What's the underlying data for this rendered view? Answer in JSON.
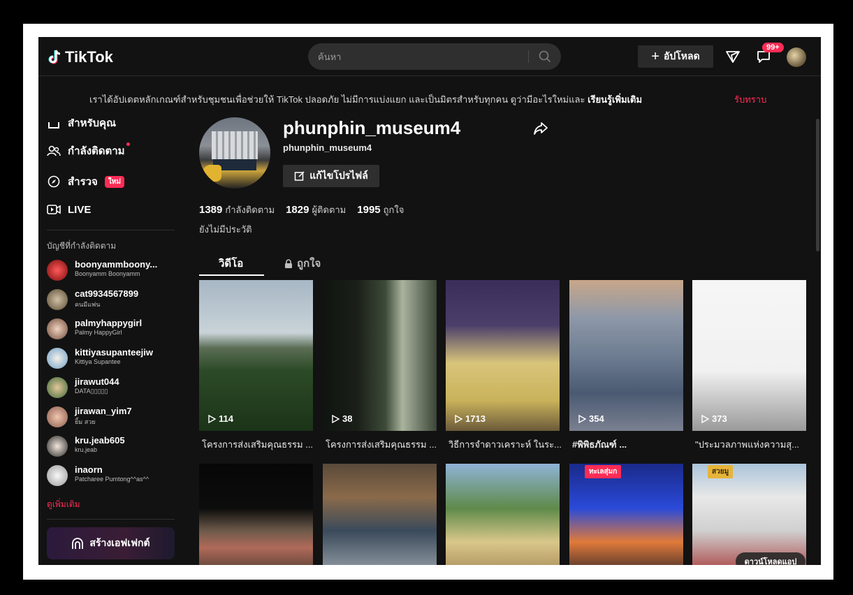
{
  "header": {
    "logo_text": "TikTok",
    "search_placeholder": "ค้นหา",
    "upload_label": "อัปโหลด",
    "notification_badge": "99+"
  },
  "notice": {
    "text": "เราได้อัปเดตหลักเกณฑ์สำหรับชุมชนเพื่อช่วยให้ TikTok ปลอดภัย ไม่มีการแบ่งแยก และเป็นมิตรสำหรับทุกคน ดูว่ามีอะไรใหม่และ ",
    "link": "เรียนรู้เพิ่มเติม",
    "dismiss": "รับทราบ"
  },
  "sidebar": {
    "nav": [
      {
        "label": "สำหรับคุณ",
        "icon": "home-icon"
      },
      {
        "label": "กำลังติดตาม",
        "icon": "people-icon"
      },
      {
        "label": "สำรวจ",
        "icon": "compass-icon",
        "badge": "ใหม่"
      },
      {
        "label": "LIVE",
        "icon": "live-icon"
      }
    ],
    "following_title": "บัญชีที่กำลังติดตาม",
    "accounts": [
      {
        "username": "boonyammboony...",
        "name": "Boonyamm Boonyamm"
      },
      {
        "username": "cat9934567899",
        "name": "คนมีแฟน"
      },
      {
        "username": "palmyhappygirl",
        "name": "Palmy HappyGirl"
      },
      {
        "username": "kittiyasupanteejiw",
        "name": "Kittiya Supantee"
      },
      {
        "username": "jirawut044",
        "name": "DATA▯▯▯▯▯"
      },
      {
        "username": "jirawan_yim7",
        "name": "ยิ้ม สวย"
      },
      {
        "username": "kru.jeab605",
        "name": "kru.jeab"
      },
      {
        "username": "inaorn",
        "name": "Patcharee Pumtong^^as^^"
      }
    ],
    "see_more": "ดูเพิ่มเติม",
    "create_effect": "สร้างเอฟเฟกต์"
  },
  "profile": {
    "username": "phunphin_museum4",
    "nickname": "phunphin_museum4",
    "edit_label": "แก้ไขโปรไฟล์",
    "following_count": "1389",
    "following_label": "กำลังติดตาม",
    "followers_count": "1829",
    "followers_label": "ผู้ติดตาม",
    "likes_count": "1995",
    "likes_label": "ถูกใจ",
    "bio": "ยังไม่มีประวัติ"
  },
  "tabs": {
    "videos": "วิดีโอ",
    "liked": "ถูกใจ"
  },
  "videos": [
    {
      "views": "114",
      "caption": "โครงการส่งเสริมคุณธรรม ..."
    },
    {
      "views": "38",
      "caption": "โครงการส่งเสริมคุณธรรม ..."
    },
    {
      "views": "1713",
      "caption": "วิธีการจำดาวเคราะห์ ในระ..."
    },
    {
      "views": "354",
      "caption": "#พิพิธภัณฑ์ ..."
    },
    {
      "views": "373",
      "caption": "\"ประมวลภาพแห่งความสุ..."
    }
  ],
  "row2": {
    "pill_4": "ทะเลสุ่มก",
    "pill_5": "สวยมู",
    "download_app": "ดาวน์โหลดแอป"
  },
  "colors": {
    "accent": "#fe2c55",
    "background": "#121212"
  }
}
